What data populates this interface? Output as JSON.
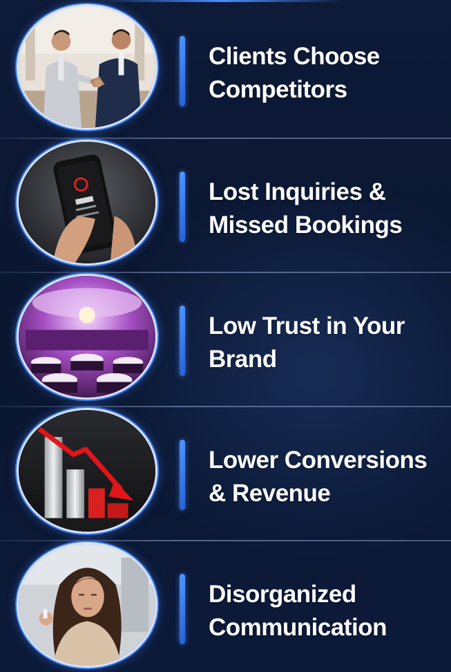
{
  "items": [
    {
      "icon": "handshake-photo",
      "line1": "Clients Choose",
      "line2": "Competitors"
    },
    {
      "icon": "smartphone-photo",
      "line1": "Lost Inquiries &",
      "line2": "Missed Bookings"
    },
    {
      "icon": "banquet-hall-photo",
      "line1": "Low Trust in Your",
      "line2": "Brand"
    },
    {
      "icon": "declining-chart-photo",
      "line1": "Lower Conversions",
      "line2": "& Revenue"
    },
    {
      "icon": "stressed-woman-photo",
      "line1": "Disorganized",
      "line2": "Communication"
    }
  ],
  "colors": {
    "background": "#0b1630",
    "accent": "#3a7cf0",
    "text": "#ffffff"
  }
}
